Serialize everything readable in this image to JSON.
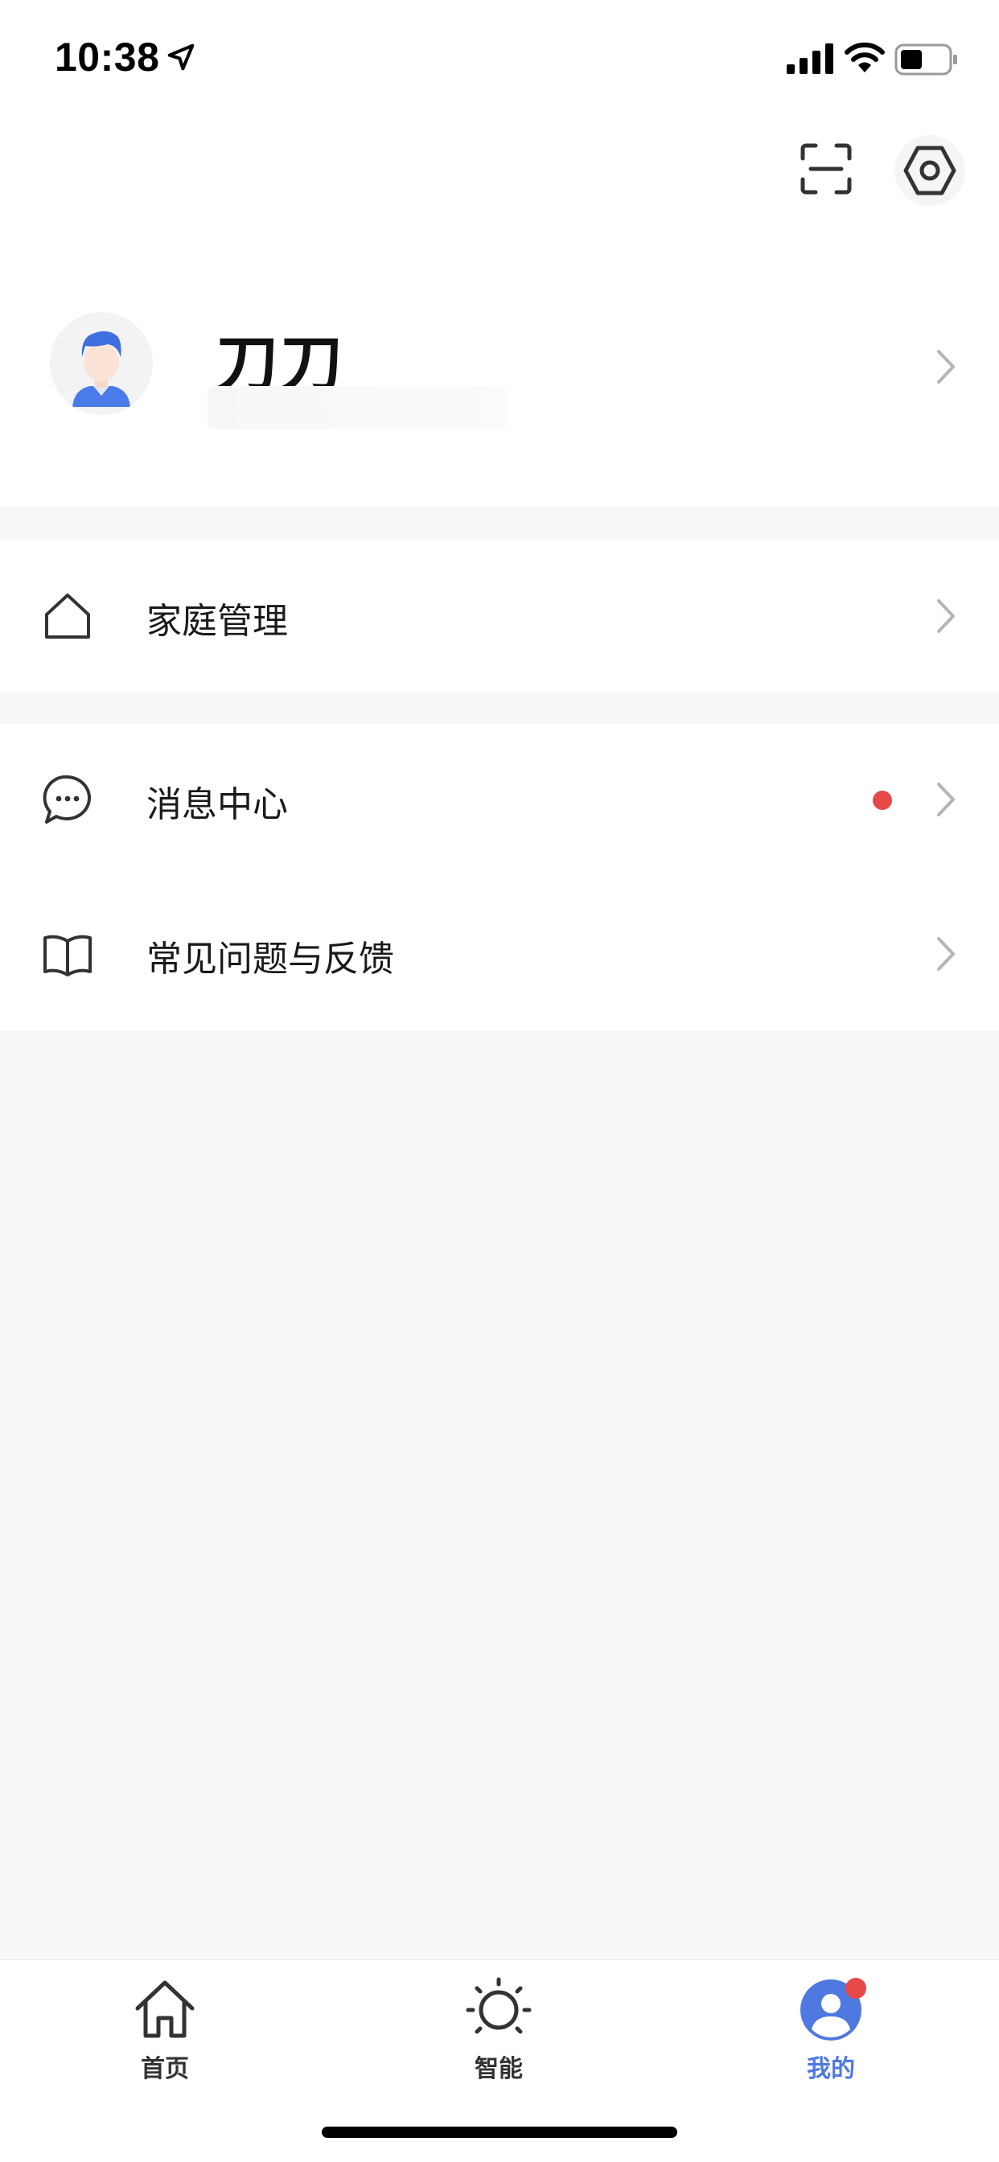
{
  "status_bar": {
    "time": "10:38"
  },
  "profile": {
    "name": "刀刀"
  },
  "menu": {
    "family": {
      "label": "家庭管理"
    },
    "messages": {
      "label": "消息中心",
      "has_unread_dot": true
    },
    "faq": {
      "label": "常见问题与反馈"
    }
  },
  "tabbar": {
    "tabs": [
      {
        "label": "首页",
        "icon": "home-icon",
        "active": false
      },
      {
        "label": "智能",
        "icon": "sun-icon",
        "active": false
      },
      {
        "label": "我的",
        "icon": "profile-icon",
        "active": true,
        "badge": true
      }
    ]
  },
  "colors": {
    "accent": "#4f79e0",
    "badge": "#e74848",
    "background": "#f7f7f7",
    "card": "#ffffff"
  }
}
